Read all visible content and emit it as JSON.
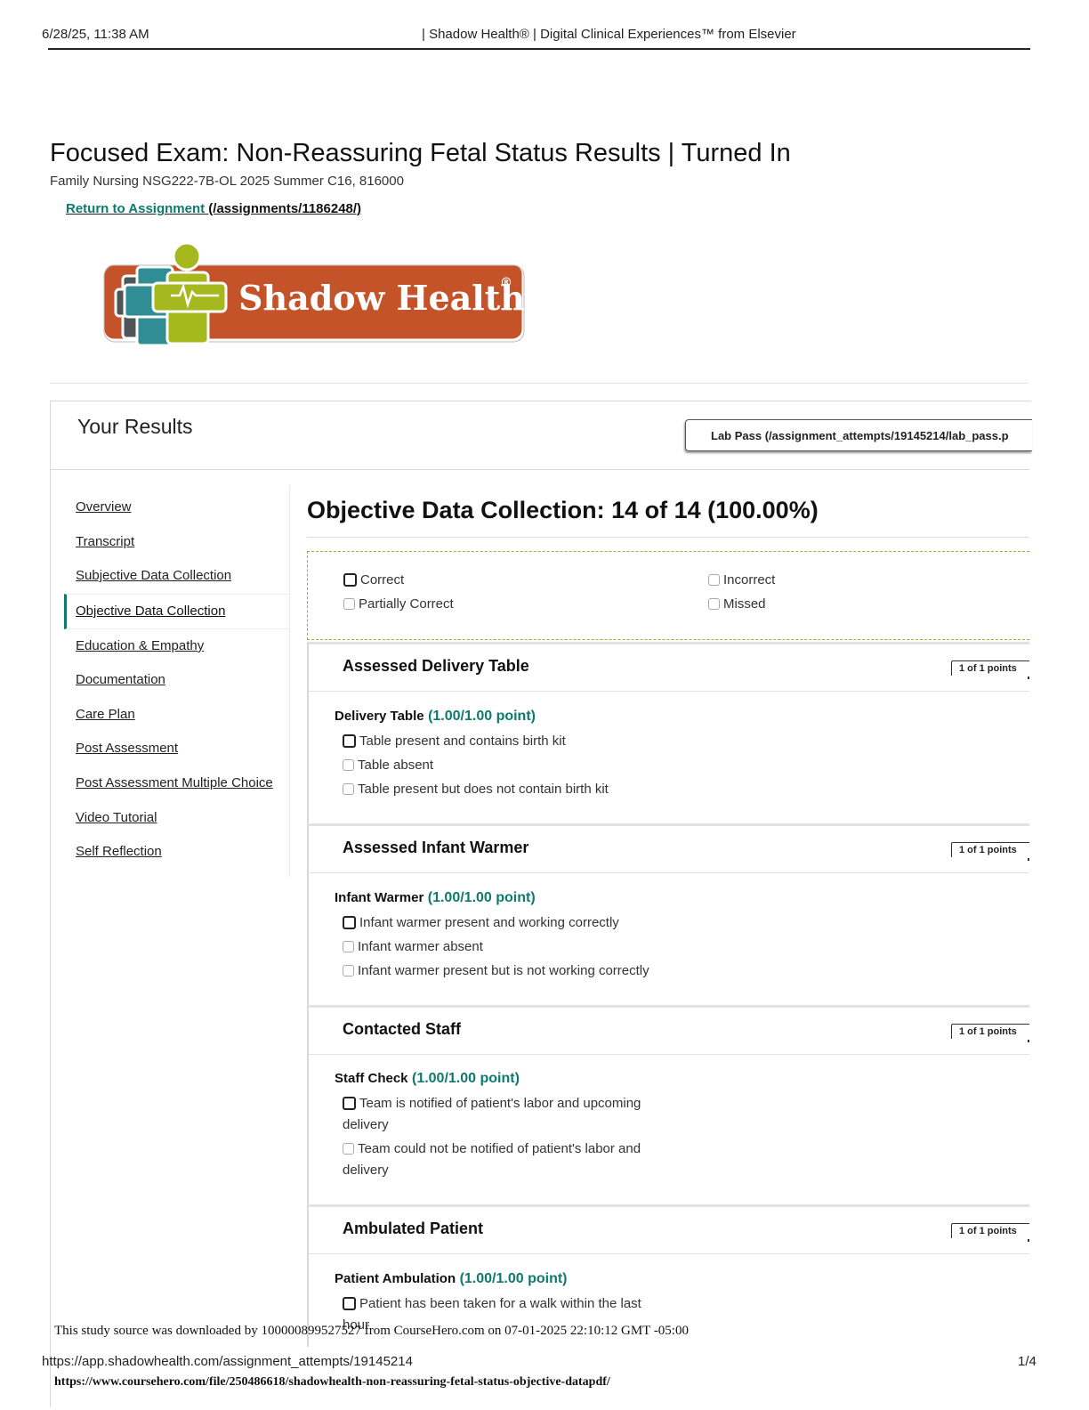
{
  "print_header": {
    "datetime": "6/28/25, 11:38 AM",
    "page_title": "| Shadow Health® | Digital Clinical Experiences™ from Elsevier"
  },
  "page": {
    "title": "Focused Exam: Non-Reassuring Fetal Status Results | Turned In",
    "subtitle": "Family Nursing NSG222-7B-OL 2025 Summer C16, 816000",
    "return_link_text": "Return to Assignment",
    "return_link_url": "(/assignments/1186248/)"
  },
  "logo": {
    "text": "Shadow Health",
    "mark": "®",
    "colors": {
      "orange": "#c4532a",
      "green": "#a5b91f",
      "teal": "#2f8d93",
      "gray": "#4d5558"
    }
  },
  "results": {
    "title": "Your Results",
    "lab_pass_label": "Lab Pass (/assignment_attempts/19145214/lab_pass.p"
  },
  "sidebar": {
    "items": [
      {
        "label": "Overview"
      },
      {
        "label": "Transcript"
      },
      {
        "label": "Subjective Data Collection"
      },
      {
        "label": "Objective Data Collection",
        "active": true
      },
      {
        "label": "Education & Empathy"
      },
      {
        "label": "Documentation"
      },
      {
        "label": "Care Plan"
      },
      {
        "label": "Post Assessment"
      },
      {
        "label": "Post Assessment Multiple Choice"
      },
      {
        "label": "Video Tutorial"
      },
      {
        "label": "Self Reflection"
      }
    ]
  },
  "main": {
    "section_title": "Objective Data Collection: 14 of 14 (100.00%)",
    "legend": {
      "correct": "Correct",
      "incorrect": "Incorrect",
      "partially_correct": "Partially Correct",
      "missed": "Missed"
    },
    "cards": [
      {
        "title": "Assessed Delivery Table",
        "points": "1 of 1 points",
        "question": "Delivery Table",
        "score": "(1.00/1.00 point)",
        "options": [
          {
            "text": "Table present and contains birth kit",
            "selected": true
          },
          {
            "text": "Table absent",
            "selected": false
          },
          {
            "text": "Table present but does not contain birth kit",
            "selected": false
          }
        ]
      },
      {
        "title": "Assessed Infant Warmer",
        "points": "1 of 1 points",
        "question": "Infant Warmer",
        "score": "(1.00/1.00 point)",
        "options": [
          {
            "text": "Infant warmer present and working correctly",
            "selected": true
          },
          {
            "text": "Infant warmer absent",
            "selected": false
          },
          {
            "text": "Infant warmer present but is not working correctly",
            "selected": false
          }
        ]
      },
      {
        "title": "Contacted Staff",
        "points": "1 of 1 points",
        "question": "Staff Check",
        "score": "(1.00/1.00 point)",
        "options": [
          {
            "text_line1": "Team is notified of patient's labor and upcoming",
            "text_line2": "delivery",
            "selected": true
          },
          {
            "text_line1": "Team could not be notified of patient's labor and",
            "text_line2": "delivery",
            "selected": false
          }
        ]
      },
      {
        "title": "Ambulated Patient",
        "points": "1 of 1 points",
        "question": "Patient Ambulation",
        "score": "(1.00/1.00 point)",
        "options": [
          {
            "text_line1": "Patient has been taken for a walk within the last",
            "text_line2": "hour",
            "selected": true
          }
        ]
      }
    ]
  },
  "footer": {
    "study_source": "This study source was downloaded by 100000899527527 from CourseHero.com on 07-01-2025 22:10:12 GMT -05:00",
    "url": "https://app.shadowhealth.com/assignment_attempts/19145214",
    "page_number": "1/4",
    "coursehero_url": "https://www.coursehero.com/file/250486618/shadowhealth-non-reassuring-fetal-status-objective-datapdf/"
  }
}
